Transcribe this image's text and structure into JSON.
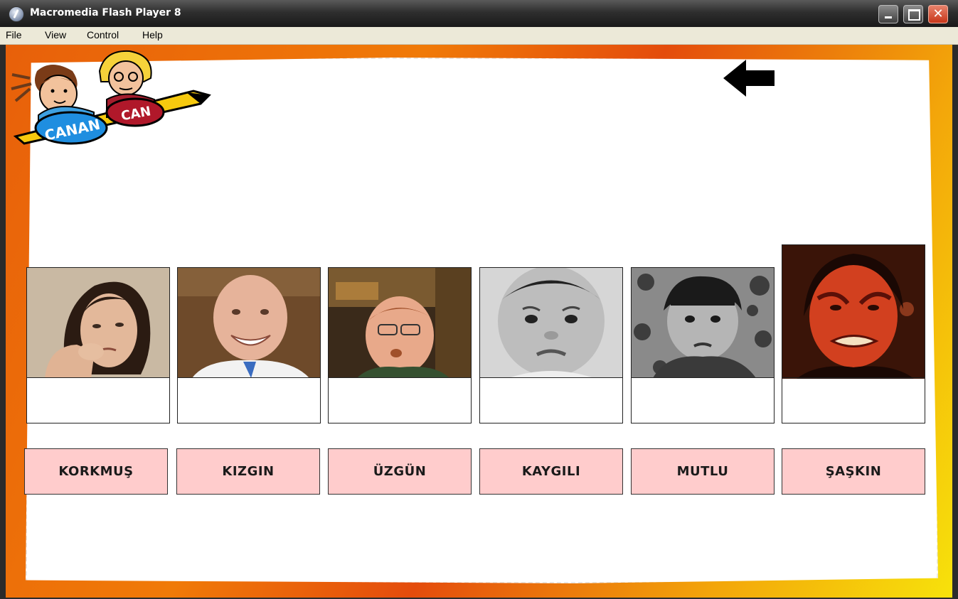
{
  "window": {
    "title": "Macromedia Flash Player 8",
    "close_glyph": "✕"
  },
  "menu": [
    {
      "label": "File"
    },
    {
      "label": "View"
    },
    {
      "label": "Control"
    },
    {
      "label": "Help"
    }
  ],
  "logo": {
    "girl_name": "CANAN",
    "boy_name": "CAN"
  },
  "back_button": {
    "icon": "left-arrow-icon"
  },
  "photos": [
    {
      "subject": "woman-worried"
    },
    {
      "subject": "bald-man-smiling"
    },
    {
      "subject": "man-glasses-sad"
    },
    {
      "subject": "baby-frowning"
    },
    {
      "subject": "boy-sulking"
    },
    {
      "subject": "man-angry-red"
    }
  ],
  "words": [
    {
      "label": "KORKMUŞ"
    },
    {
      "label": "KIZGIN"
    },
    {
      "label": "ÜZGÜN"
    },
    {
      "label": "KAYGILI"
    },
    {
      "label": "MUTLU"
    },
    {
      "label": "ŞAŞKIN"
    }
  ],
  "colors": {
    "word_button": "#ffcccc",
    "stage_orange": "#f07a08",
    "stage_yellow": "#f7e20b"
  }
}
